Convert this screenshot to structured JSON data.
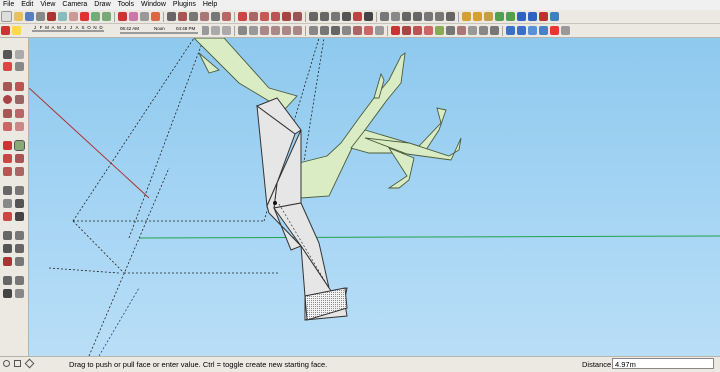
{
  "menu": [
    "File",
    "Edit",
    "View",
    "Camera",
    "Draw",
    "Tools",
    "Window",
    "Plugins",
    "Help"
  ],
  "shadow_settings": {
    "months": [
      "J",
      "F",
      "M",
      "A",
      "M",
      "J",
      "J",
      "A",
      "S",
      "O",
      "N",
      "D"
    ],
    "time_start": "06:42 AM",
    "time_noon": "Noon",
    "time_end": "04:48 PM"
  },
  "status": {
    "message": "Drag to push or pull face or enter value.  Ctrl = toggle create new starting face."
  },
  "measurements": {
    "label": "Distance",
    "value": "4.97m"
  },
  "colors": {
    "sky_top": "#8ec9ee",
    "sky_bottom": "#b9def7",
    "tree_green": "#d9ecc3",
    "selected_face": "#ffffff",
    "green_axis": "#1fa34a",
    "red_axis": "#b03030"
  },
  "icons": {
    "left_toolbar": [
      "select-icon",
      "eraser-icon",
      "paint-bucket-icon",
      "rectangle-icon",
      "line-icon",
      "circle-icon",
      "arc-icon",
      "polygon-icon",
      "freehand-icon",
      "move-icon",
      "push-pull-icon",
      "rotate-icon",
      "follow-me-icon",
      "scale-icon",
      "offset-icon",
      "tape-measure-icon",
      "dimension-icon",
      "protractor-icon",
      "text-icon",
      "axes-icon",
      "3d-text-icon",
      "orbit-icon",
      "pan-icon",
      "zoom-icon",
      "zoom-window-icon",
      "zoom-extents-icon",
      "walk-icon",
      "look-around-icon",
      "position-camera-icon",
      "section-plane-icon"
    ]
  }
}
